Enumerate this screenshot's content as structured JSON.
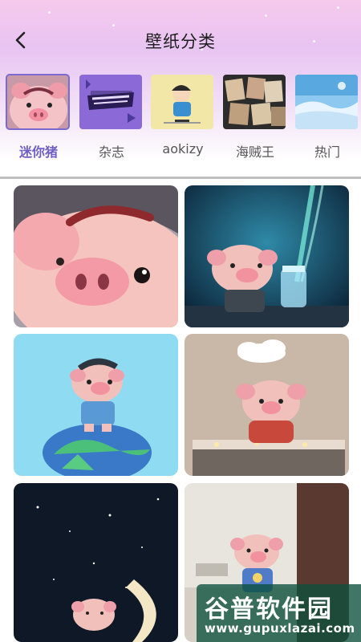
{
  "header": {
    "title": "壁纸分类"
  },
  "categories": [
    {
      "label": "迷你猪",
      "selected": true,
      "thumb_icon": "pig-thumbnail"
    },
    {
      "label": "杂志",
      "selected": false,
      "thumb_icon": "magazine-thumbnail"
    },
    {
      "label": "aokizy",
      "selected": false,
      "thumb_icon": "aokizy-thumbnail"
    },
    {
      "label": "海贼王",
      "selected": false,
      "thumb_icon": "one-piece-thumbnail"
    },
    {
      "label": "热门",
      "selected": false,
      "thumb_icon": "hot-thumbnail"
    }
  ],
  "colors": {
    "accent": "#6f60c8",
    "header_gradient_top": "#f6c9ec",
    "watermark_bg": "#0c503c"
  },
  "watermark": {
    "title": "谷普软件园",
    "url": "www.gupuxlazai.com"
  }
}
